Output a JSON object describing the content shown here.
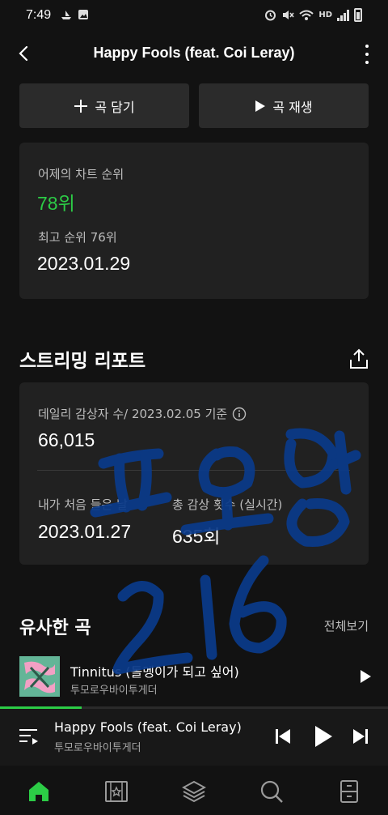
{
  "status_bar": {
    "time": "7:49",
    "hd_label": "HD"
  },
  "header": {
    "title": "Happy Fools (feat. Coi Leray)"
  },
  "actions": {
    "add_label": "곡 담기",
    "play_label": "곡 재생"
  },
  "chart_rank": {
    "yesterday_label": "어제의 차트 순위",
    "yesterday_value": "78위",
    "best_label": "최고 순위 76위",
    "best_date": "2023.01.29"
  },
  "streaming_report": {
    "title": "스트리밍 리포트",
    "daily_label": "데일리 감상자 수/ 2023.02.05 기준",
    "daily_value": "66,015",
    "first_listen_label": "내가 처음 들은 날",
    "first_listen_value": "2023.01.27",
    "total_plays_label": "총 감상 횟수 (실시간)",
    "total_plays_value": "635회"
  },
  "similar": {
    "title": "유사한 곡",
    "see_all": "전체보기",
    "items": [
      {
        "title": "Tinnitus (돌멩이가 되고 싶어)",
        "artist": "투모로우바이투게더"
      }
    ]
  },
  "mini_player": {
    "title": "Happy Fools (feat. Coi Leray)",
    "artist": "투모로우바이투게더",
    "progress": 0.21
  },
  "nav": [
    "home-icon",
    "library-icon",
    "layers-icon",
    "search-icon",
    "drawer-icon"
  ],
  "colors": {
    "accent": "#2ccc46",
    "handwriting": "#0a3a8a"
  }
}
